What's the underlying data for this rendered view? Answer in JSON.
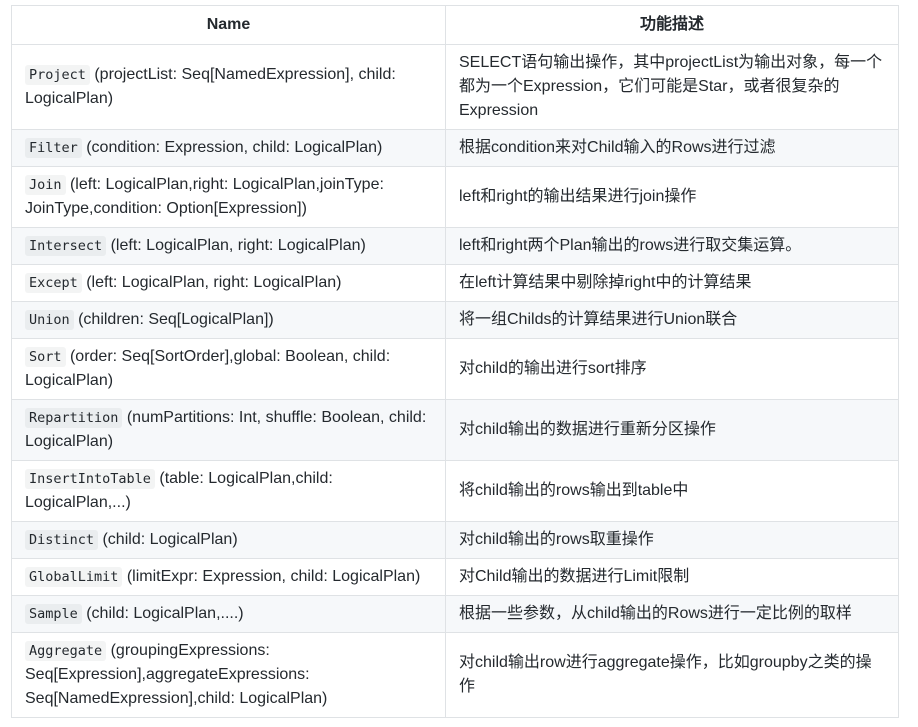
{
  "table": {
    "headers": [
      "Name",
      "功能描述"
    ],
    "rows": [
      {
        "code": "Project",
        "args": " (projectList: Seq[NamedExpression], child: LogicalPlan)",
        "desc": "SELECT语句输出操作，其中projectList为输出对象，每一个都为一个Expression，它们可能是Star，或者很复杂的Expression",
        "h": "h3"
      },
      {
        "code": "Filter",
        "args": " (condition: Expression, child: LogicalPlan)",
        "desc": "根据condition来对Child输入的Rows进行过滤",
        "h": "h1"
      },
      {
        "code": "Join",
        "args": " (left: LogicalPlan,right: LogicalPlan,joinType: JoinType,condition: Option[Expression])",
        "desc": "left和right的输出结果进行join操作",
        "h": "h2"
      },
      {
        "code": "Intersect",
        "args": " (left: LogicalPlan, right: LogicalPlan)",
        "desc": "left和right两个Plan输出的rows进行取交集运算。",
        "h": "h1"
      },
      {
        "code": "Except",
        "args": " (left: LogicalPlan, right: LogicalPlan)",
        "desc": "在left计算结果中剔除掉right中的计算结果",
        "h": "h1"
      },
      {
        "code": "Union",
        "args": " (children: Seq[LogicalPlan])",
        "desc": "将一组Childs的计算结果进行Union联合",
        "h": "h1"
      },
      {
        "code": "Sort",
        "args": " (order: Seq[SortOrder],global: Boolean, child: LogicalPlan)",
        "desc": "对child的输出进行sort排序",
        "h": "h2"
      },
      {
        "code": "Repartition",
        "args": " (numPartitions: Int, shuffle: Boolean, child: LogicalPlan)",
        "desc": "对child输出的数据进行重新分区操作",
        "h": "h2"
      },
      {
        "code": "InsertIntoTable",
        "args": " (table: LogicalPlan,child: LogicalPlan,...)",
        "desc": "将child输出的rows输出到table中",
        "h": "h2"
      },
      {
        "code": "Distinct",
        "args": " (child: LogicalPlan)",
        "desc": "对child输出的rows取重操作",
        "h": "h1"
      },
      {
        "code": "GlobalLimit",
        "args": " (limitExpr: Expression, child: LogicalPlan)",
        "desc": "对Child输出的数据进行Limit限制",
        "h": "h1"
      },
      {
        "code": "Sample",
        "args": " (child: LogicalPlan,....)",
        "desc": "根据一些参数，从child输出的Rows进行一定比例的取样",
        "h": "h1"
      },
      {
        "code": "Aggregate",
        "args": " (groupingExpressions: Seq[Expression],aggregateExpressions: Seq[NamedExpression],child: LogicalPlan)",
        "desc": "对child输出row进行aggregate操作，比如groupby之类的操作",
        "h": "h3"
      }
    ]
  }
}
